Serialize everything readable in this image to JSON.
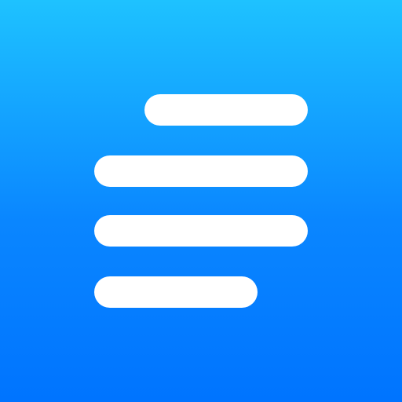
{
  "icon": {
    "name": "text-align-lines-icon",
    "colors": {
      "gradient_top": "#1EC2FF",
      "gradient_mid": "#0A86FF",
      "gradient_bottom": "#0074FF",
      "bars": "#FFFFFF"
    }
  }
}
